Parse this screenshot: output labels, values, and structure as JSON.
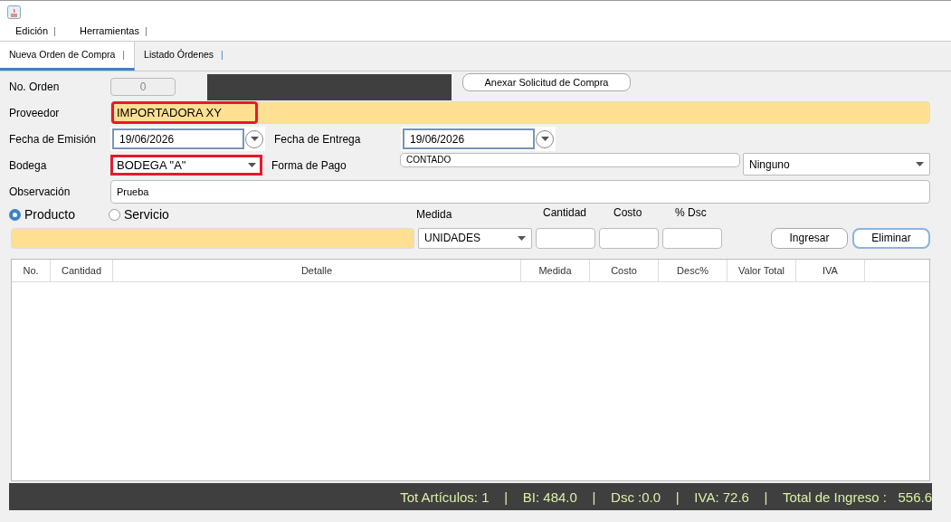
{
  "menu": [
    {
      "label": "Edición",
      "separator": "|"
    },
    {
      "label": "Herramientas",
      "separator": "|"
    }
  ],
  "tabs": [
    {
      "label": "Nueva Orden de Compra",
      "separator": "|",
      "selected": true
    },
    {
      "label": "Listado Órdenes",
      "separator": "|",
      "selected": false
    }
  ],
  "order": {
    "label": "No. Orden",
    "value": "0",
    "attach_button": "Anexar Solicitud de Compra"
  },
  "supplier": {
    "label": "Proveedor",
    "value": "IMPORTADORA XY",
    "highlighted": true
  },
  "issue_date": {
    "label": "Fecha de Emisión",
    "value": "19/06/2026"
  },
  "delivery_date": {
    "label": "Fecha de Entrega",
    "value": "19/06/2026"
  },
  "warehouse": {
    "label": "Bodega",
    "value": "BODEGA \"A\"",
    "highlighted": true
  },
  "payment": {
    "label": "Forma de Pago",
    "value": "CONTADO",
    "option": "Ninguno"
  },
  "notes": {
    "label": "Observación",
    "value": "Prueba"
  },
  "item_type": [
    {
      "label": "Producto",
      "selected": true
    },
    {
      "label": "Servicio",
      "selected": false
    }
  ],
  "entry": {
    "unit_label": "Medida",
    "unit": "UNIDADES",
    "quantity_label": "Cantidad",
    "cost_label": "Costo",
    "discount_label": "% Dsc",
    "buttons": [
      {
        "label": "Ingresar",
        "focused": false
      },
      {
        "label": "Eliminar",
        "focused": true
      }
    ]
  },
  "table": {
    "columns": [
      "No.",
      "Cantidad",
      "Detalle",
      "Medida",
      "Costo",
      "Desc%",
      "Valor Total",
      "IVA"
    ]
  },
  "status_bar": "Tot Artículos: 1    |    BI: 484.0    |    Dsc :0.0    |    IVA: 72.6    |    Total de Ingreso :   556.6"
}
